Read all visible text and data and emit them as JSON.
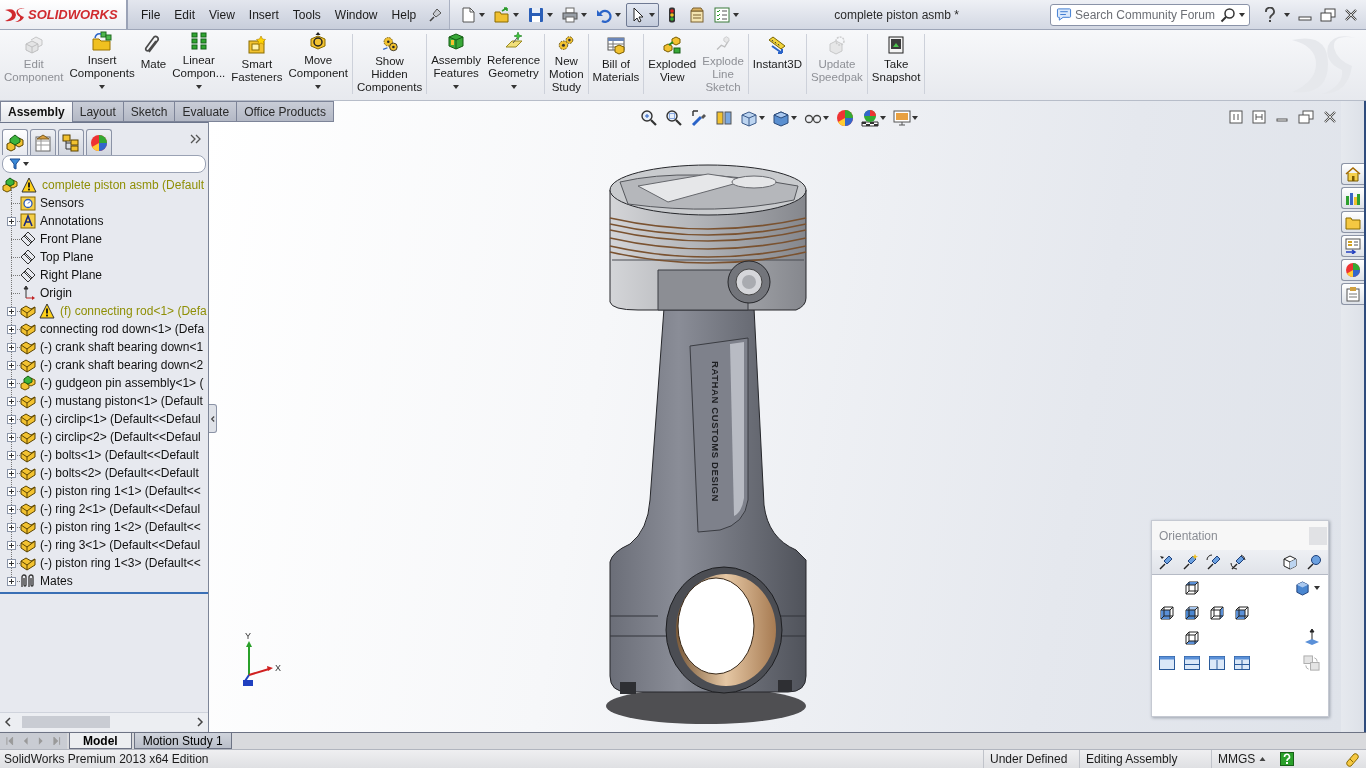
{
  "title_bar": {
    "logo": "SOLIDWORKS",
    "menus": [
      "File",
      "Edit",
      "View",
      "Insert",
      "Tools",
      "Window",
      "Help"
    ],
    "quick_access": [
      {
        "dropdown": true,
        "pressed": false
      },
      {
        "dropdown": true,
        "pressed": false
      },
      {
        "dropdown": true,
        "pressed": false
      },
      {
        "dropdown": true,
        "pressed": false
      },
      {
        "dropdown": true,
        "pressed": false
      },
      {
        "dropdown": true,
        "pressed": true
      },
      {
        "dropdown": false,
        "pressed": false
      },
      {
        "dropdown": false,
        "pressed": false
      },
      {
        "dropdown": true,
        "pressed": false
      }
    ],
    "document_title": "complete piston asmb *",
    "search": {
      "placeholder": "Search Community Forum"
    }
  },
  "command_manager": {
    "groups": [
      [
        {
          "label": "Edit\nComponent",
          "disabled": true,
          "dropdown": false
        },
        {
          "label": "Insert\nComponents",
          "disabled": false,
          "dropdown": true
        },
        {
          "label": "Mate",
          "disabled": false,
          "dropdown": false
        },
        {
          "label": "Linear\nCompon...",
          "disabled": false,
          "dropdown": true
        },
        {
          "label": "Smart\nFasteners",
          "disabled": false,
          "dropdown": false
        },
        {
          "label": "Move\nComponent",
          "disabled": false,
          "dropdown": true
        }
      ],
      [
        {
          "label": "Show\nHidden\nComponents",
          "disabled": false,
          "dropdown": false
        }
      ],
      [
        {
          "label": "Assembly\nFeatures",
          "disabled": false,
          "dropdown": true
        },
        {
          "label": "Reference\nGeometry",
          "disabled": false,
          "dropdown": true
        }
      ],
      [
        {
          "label": "New\nMotion\nStudy",
          "disabled": false,
          "dropdown": false
        }
      ],
      [
        {
          "label": "Bill of\nMaterials",
          "disabled": false,
          "dropdown": false
        }
      ],
      [
        {
          "label": "Exploded\nView",
          "disabled": false,
          "dropdown": false
        },
        {
          "label": "Explode\nLine\nSketch",
          "disabled": true,
          "dropdown": false
        }
      ],
      [
        {
          "label": "Instant3D",
          "disabled": false,
          "dropdown": false
        }
      ],
      [
        {
          "label": "Update\nSpeedpak",
          "disabled": true,
          "dropdown": false
        }
      ],
      [
        {
          "label": "Take\nSnapshot",
          "disabled": false,
          "dropdown": false
        }
      ]
    ]
  },
  "command_tabs": [
    {
      "label": "Assembly",
      "selected": true
    },
    {
      "label": "Layout",
      "selected": false
    },
    {
      "label": "Sketch",
      "selected": false
    },
    {
      "label": "Evaluate",
      "selected": false
    },
    {
      "label": "Office Products",
      "selected": false
    }
  ],
  "feature_manager": {
    "tabs": [
      {
        "selected": true
      },
      {
        "selected": false
      },
      {
        "selected": false
      },
      {
        "selected": false
      }
    ],
    "tree": [
      {
        "kind": "assembly",
        "label": "complete piston asmb (Default",
        "warning": true,
        "children": [
          {
            "kind": "sensors",
            "label": "Sensors",
            "warning": false
          },
          {
            "kind": "annotations",
            "label": "Annotations",
            "warning": false,
            "expanded": false
          },
          {
            "kind": "plane",
            "label": "Front Plane",
            "warning": false
          },
          {
            "kind": "plane",
            "label": "Top Plane",
            "warning": false
          },
          {
            "kind": "plane",
            "label": "Right Plane",
            "warning": false
          },
          {
            "kind": "origin",
            "label": "Origin",
            "warning": false
          },
          {
            "kind": "part",
            "label": "(f) connecting rod<1> (Defa",
            "warning": true,
            "expanded": false
          },
          {
            "kind": "part",
            "label": "connecting rod down<1> (Defa",
            "warning": false,
            "expanded": false
          },
          {
            "kind": "part",
            "label": "(-) crank shaft bearing down<1",
            "warning": false,
            "expanded": false
          },
          {
            "kind": "part",
            "label": "(-) crank shaft bearing down<2",
            "warning": false,
            "expanded": false
          },
          {
            "kind": "assembly",
            "label": "(-) gudgeon pin assembly<1> (",
            "warning": false,
            "expanded": false
          },
          {
            "kind": "part",
            "label": "(-) mustang piston<1> (Default",
            "warning": false,
            "expanded": false
          },
          {
            "kind": "part",
            "label": "(-) circlip<1> (Default<<Defaul",
            "warning": false,
            "expanded": false
          },
          {
            "kind": "part",
            "label": "(-) circlip<2> (Default<<Defaul",
            "warning": false,
            "expanded": false
          },
          {
            "kind": "part",
            "label": "(-) bolts<1> (Default<<Default",
            "warning": false,
            "expanded": false
          },
          {
            "kind": "part",
            "label": "(-) bolts<2> (Default<<Default",
            "warning": false,
            "expanded": false
          },
          {
            "kind": "part",
            "label": "(-) piston ring 1<1> (Default<<",
            "warning": false,
            "expanded": false
          },
          {
            "kind": "part",
            "label": "(-) ring 2<1> (Default<<Defaul",
            "warning": false,
            "expanded": false
          },
          {
            "kind": "part",
            "label": "(-) piston ring 1<2> (Default<<",
            "warning": false,
            "expanded": false
          },
          {
            "kind": "part",
            "label": "(-) ring 3<1> (Default<<Defaul",
            "warning": false,
            "expanded": false
          },
          {
            "kind": "part",
            "label": "(-) piston ring 1<3> (Default<<",
            "warning": false,
            "expanded": false
          },
          {
            "kind": "mates",
            "label": "Mates",
            "warning": false,
            "expanded": false
          }
        ]
      }
    ]
  },
  "view_toolbar": [
    {
      "dropdown": false
    },
    {
      "dropdown": false
    },
    {
      "dropdown": false
    },
    {
      "dropdown": false
    },
    {
      "dropdown": true
    },
    {
      "dropdown": true
    },
    {
      "dropdown": true
    },
    {
      "dropdown": false
    },
    {
      "dropdown": true
    },
    {
      "dropdown": true
    }
  ],
  "model": {
    "engraving": "RATHAN CUSTOMS DESIGN"
  },
  "triad": {
    "labels": [
      "Y",
      "X"
    ]
  },
  "orientation_panel": {
    "title": "Orientation"
  },
  "bottom_tabs": [
    {
      "label": "Model",
      "selected": true
    },
    {
      "label": "Motion Study 1",
      "selected": false
    }
  ],
  "status_bar": {
    "product": "SolidWorks Premium 2013 x64 Edition",
    "fields": [
      "Under Defined",
      "Editing Assembly",
      "MMGS"
    ]
  }
}
